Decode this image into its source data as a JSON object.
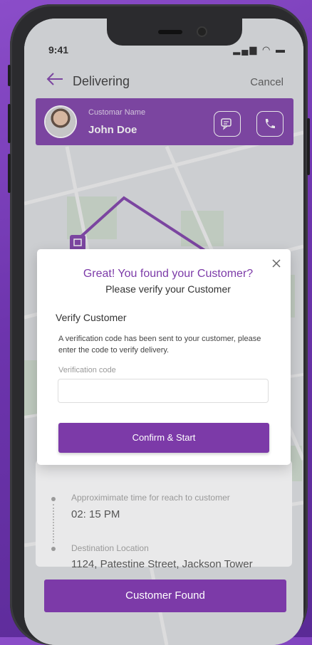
{
  "status_bar": {
    "time": "9:41",
    "icons": "▂▄▆ ◠ ▬"
  },
  "header": {
    "title": "Delivering",
    "cancel_label": "Cancel"
  },
  "customer": {
    "label": "Customar Name",
    "name": "John Doe"
  },
  "modal": {
    "title": "Great! You found your Customer?",
    "subtitle": "Please verify your Customer",
    "section_title": "Verify Customer",
    "message": "A verification code has been sent to your customer, please enter the code to verify delivery.",
    "code_label": "Verification code",
    "code_value": "",
    "confirm_label": "Confirm & Start"
  },
  "details": {
    "eta_label": "Approximimate time for reach to customer",
    "eta_value": "02: 15 PM",
    "destination_label": "Destination Location",
    "destination_value": "1124, Patestine Street, Jackson Tower"
  },
  "footer": {
    "found_label": "Customer Found"
  },
  "colors": {
    "accent": "#7c3aa8",
    "background": "#6d34ad"
  }
}
